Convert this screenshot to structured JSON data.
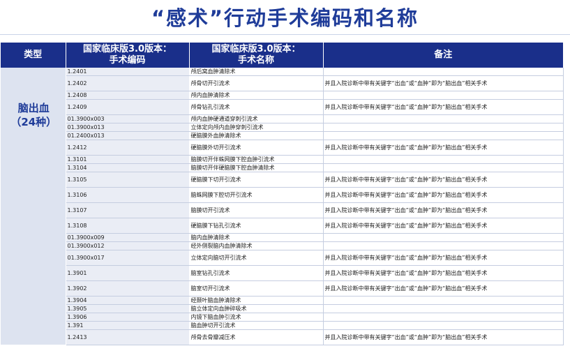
{
  "page_title": "“感术”行动手术编码和名称",
  "table": {
    "headers": [
      "类型",
      "国家临床版3.0版本：\n手术编码",
      "国家临床版3.0版本：\n手术名称",
      "备注"
    ],
    "header_code_line1": "国家临床版3.0版本：",
    "header_code_line2": "手术编码",
    "header_name_line1": "国家临床版3.0版本：",
    "header_name_line2": "手术名称",
    "type_line1": "脑出血",
    "type_line2": "（24种）",
    "rows": [
      {
        "code": "1.2401",
        "name": "颅后窝血肿清除术",
        "note": ""
      },
      {
        "code": "1.2402",
        "name": "颅骨切开引流术",
        "note": "并且入院诊断中带有关键字“出血”或“血肿”即为“脑出血”相关手术"
      },
      {
        "code": "1.2408",
        "name": "颅内血肿清除术",
        "note": ""
      },
      {
        "code": "1.2409",
        "name": "颅骨钻孔引流术",
        "note": "并且入院诊断中带有关键字“出血”或“血肿”即为“脑出血”相关手术"
      },
      {
        "code": "01.3900x003",
        "name": "颅内血肿硬通道穿刺引流术",
        "note": ""
      },
      {
        "code": "01.3900x013",
        "name": "立体定向颅内血肿穿刺引流术",
        "note": ""
      },
      {
        "code": "01.2400x013",
        "name": "硬脑膜外血肿清除术",
        "note": ""
      },
      {
        "code": "1.2412",
        "name": "硬脑膜外切开引流术",
        "note": "并且入院诊断中带有关键字“出血”或“血肿”即为“脑出血”相关手术"
      },
      {
        "code": "1.3101",
        "name": "脑膜切开伴蛛网膜下腔血肿引流术",
        "note": ""
      },
      {
        "code": "1.3104",
        "name": "脑膜切开伴硬脑膜下腔血肿清除术",
        "note": ""
      },
      {
        "code": "1.3105",
        "name": "硬脑膜下切开引流术",
        "note": "并且入院诊断中带有关键字“出血”或“血肿”即为“脑出血”相关手术"
      },
      {
        "code": "1.3106",
        "name": "脑蛛网膜下腔切开引流术",
        "note": "并且入院诊断中带有关键字“出血”或“血肿”即为“脑出血”相关手术"
      },
      {
        "code": "1.3107",
        "name": "脑膜切开引流术",
        "note": "并且入院诊断中带有关键字“出血”或“血肿”即为“脑出血”相关手术"
      },
      {
        "code": "1.3108",
        "name": "硬脑膜下钻孔引流术",
        "note": "并且入院诊断中带有关键字“出血”或“血肿”即为“脑出血”相关手术"
      },
      {
        "code": "01.3900x009",
        "name": "脑内血肿清除术",
        "note": ""
      },
      {
        "code": "01.3900x012",
        "name": "经外侧裂脑内血肿清除术",
        "note": ""
      },
      {
        "code": "01.3900x017",
        "name": "立体定向脑切开引流术",
        "note": "并且入院诊断中带有关键字“出血”或“血肿”即为“脑出血”相关手术"
      },
      {
        "code": "1.3901",
        "name": "脑室钻孔引流术",
        "note": "并且入院诊断中带有关键字“出血”或“血肿”即为“脑出血”相关手术"
      },
      {
        "code": "1.3902",
        "name": "脑室切开引流术",
        "note": "并且入院诊断中带有关键字“出血”或“血肿”即为“脑出血”相关手术"
      },
      {
        "code": "1.3904",
        "name": "经颞叶脑血肿清除术",
        "note": ""
      },
      {
        "code": "1.3905",
        "name": "脑立体定向血肿碎吸术",
        "note": ""
      },
      {
        "code": "1.3906",
        "name": "内镜下脑血肿引流术",
        "note": ""
      },
      {
        "code": "1.391",
        "name": "脑血肿切开引流术",
        "note": ""
      },
      {
        "code": "1.2413",
        "name": "颅骨去骨瓣减压术",
        "note": "并且入院诊断中带有关键字“出血”或“血肿”即为“脑出血”相关手术"
      }
    ]
  }
}
